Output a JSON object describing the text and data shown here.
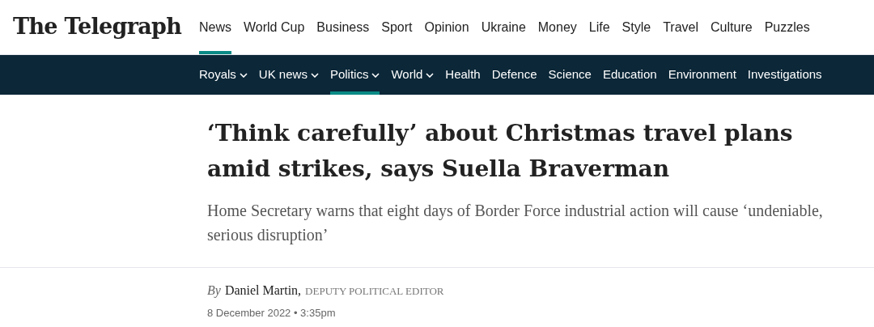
{
  "logo": "The Telegraph",
  "main_nav": [
    {
      "label": "News",
      "selected": true
    },
    {
      "label": "World Cup",
      "selected": false
    },
    {
      "label": "Business",
      "selected": false
    },
    {
      "label": "Sport",
      "selected": false
    },
    {
      "label": "Opinion",
      "selected": false
    },
    {
      "label": "Ukraine",
      "selected": false
    },
    {
      "label": "Money",
      "selected": false
    },
    {
      "label": "Life",
      "selected": false
    },
    {
      "label": "Style",
      "selected": false
    },
    {
      "label": "Travel",
      "selected": false
    },
    {
      "label": "Culture",
      "selected": false
    },
    {
      "label": "Puzzles",
      "selected": false
    }
  ],
  "sub_nav": [
    {
      "label": "Royals",
      "dropdown": true,
      "selected": false
    },
    {
      "label": "UK news",
      "dropdown": true,
      "selected": false
    },
    {
      "label": "Politics",
      "dropdown": true,
      "selected": true
    },
    {
      "label": "World",
      "dropdown": true,
      "selected": false
    },
    {
      "label": "Health",
      "dropdown": false,
      "selected": false
    },
    {
      "label": "Defence",
      "dropdown": false,
      "selected": false
    },
    {
      "label": "Science",
      "dropdown": false,
      "selected": false
    },
    {
      "label": "Education",
      "dropdown": false,
      "selected": false
    },
    {
      "label": "Environment",
      "dropdown": false,
      "selected": false
    },
    {
      "label": "Investigations",
      "dropdown": false,
      "selected": false
    }
  ],
  "article": {
    "headline": "‘Think carefully’ about Christmas travel plans amid strikes, says Suella Braverman",
    "standfirst": "Home Secretary warns that eight days of Border Force industrial action will cause ‘undeniable, serious disruption’",
    "byline": {
      "prefix": "By",
      "author": "Daniel Martin,",
      "role": "DEPUTY POLITICAL EDITOR"
    },
    "date": "8 December 2022 • 3:35pm"
  }
}
